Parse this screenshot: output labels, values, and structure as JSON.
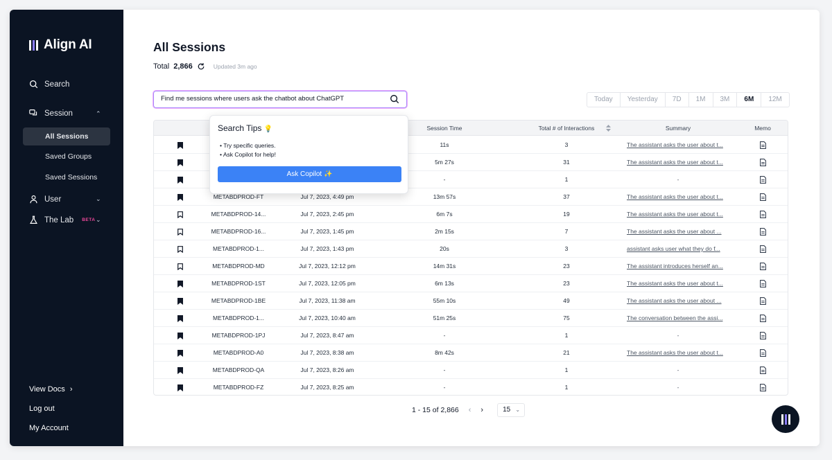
{
  "app": {
    "name": "Align AI"
  },
  "sidebar": {
    "search": "Search",
    "session": "Session",
    "sub_items": [
      "All Sessions",
      "Saved Groups",
      "Saved Sessions"
    ],
    "user": "User",
    "lab": "The Lab",
    "lab_badge": "BETA",
    "view_docs": "View Docs",
    "logout": "Log out",
    "my_account": "My Account"
  },
  "header": {
    "title": "All Sessions",
    "total_label": "Total",
    "total_value": "2,866",
    "updated": "Updated 3m ago"
  },
  "search": {
    "value": "Find me sessions where users ask the chatbot about ChatGPT"
  },
  "ranges": {
    "items": [
      "Today",
      "Yesterday",
      "7D",
      "1M",
      "3M",
      "6M",
      "12M"
    ],
    "selected": "6M"
  },
  "tips": {
    "title": "Search Tips",
    "emoji": "💡",
    "items": [
      "Try specific queries.",
      "Ask Copilot for help!"
    ],
    "button": "Ask Copilot ✨"
  },
  "table": {
    "columns": [
      "Session Time",
      "Total # of Interactions",
      "Summary",
      "Memo"
    ],
    "rows": [
      {
        "bookmarked": true,
        "id": "",
        "date": "",
        "time": "11s",
        "interactions": "3",
        "summary": "The assistant asks the user about t..."
      },
      {
        "bookmarked": true,
        "id": "",
        "date": "",
        "time": "5m 27s",
        "interactions": "31",
        "summary": "The assistant asks the user about t..."
      },
      {
        "bookmarked": true,
        "id": "",
        "date": "",
        "time": "-",
        "interactions": "1",
        "summary": "-"
      },
      {
        "bookmarked": true,
        "id": "METABDPROD-FT",
        "date": "Jul 7, 2023, 4:49 pm",
        "time": "13m 57s",
        "interactions": "37",
        "summary": "The assistant asks the user about t..."
      },
      {
        "bookmarked": false,
        "id": "METABDPROD-14...",
        "date": "Jul 7, 2023, 2:45 pm",
        "time": "6m 7s",
        "interactions": "19",
        "summary": "The assistant asks the user about t..."
      },
      {
        "bookmarked": false,
        "id": "METABDPROD-16...",
        "date": "Jul 7, 2023, 1:45 pm",
        "time": "2m 15s",
        "interactions": "7",
        "summary": "The assistant asks the user about ..."
      },
      {
        "bookmarked": false,
        "id": "METABDPROD-1...",
        "date": "Jul 7, 2023, 1:43 pm",
        "time": "20s",
        "interactions": "3",
        "summary": "assistant asks user what they do f..."
      },
      {
        "bookmarked": false,
        "id": "METABDPROD-MD",
        "date": "Jul 7, 2023, 12:12 pm",
        "time": "14m 31s",
        "interactions": "23",
        "summary": "The assistant introduces herself an..."
      },
      {
        "bookmarked": true,
        "id": "METABDPROD-1ST",
        "date": "Jul 7, 2023, 12:05 pm",
        "time": "6m 13s",
        "interactions": "23",
        "summary": "The assistant asks the user about t..."
      },
      {
        "bookmarked": true,
        "id": "METABDPROD-1BE",
        "date": "Jul 7, 2023, 11:38 am",
        "time": "55m 10s",
        "interactions": "49",
        "summary": "The assistant asks the user about ..."
      },
      {
        "bookmarked": true,
        "id": "METABDPROD-1...",
        "date": "Jul 7, 2023, 10:40 am",
        "time": "51m 25s",
        "interactions": "75",
        "summary": "The conversation between the assi..."
      },
      {
        "bookmarked": true,
        "id": "METABDPROD-1PJ",
        "date": "Jul 7, 2023, 8:47 am",
        "time": "-",
        "interactions": "1",
        "summary": "-"
      },
      {
        "bookmarked": true,
        "id": "METABDPROD-A0",
        "date": "Jul 7, 2023, 8:38 am",
        "time": "8m 42s",
        "interactions": "21",
        "summary": "The assistant asks the user about t..."
      },
      {
        "bookmarked": true,
        "id": "METABDPROD-QA",
        "date": "Jul 7, 2023, 8:26 am",
        "time": "-",
        "interactions": "1",
        "summary": "-"
      },
      {
        "bookmarked": true,
        "id": "METABDPROD-FZ",
        "date": "Jul 7, 2023, 8:25 am",
        "time": "-",
        "interactions": "1",
        "summary": "-"
      }
    ]
  },
  "pager": {
    "range": "1 - 15 of 2,866",
    "per_page": "15"
  },
  "icons": [
    "search-icon",
    "chat-icon",
    "user-icon",
    "flask-icon",
    "bookmark-icon",
    "document-icon",
    "refresh-icon",
    "sort-icon",
    "chevron-icon"
  ]
}
